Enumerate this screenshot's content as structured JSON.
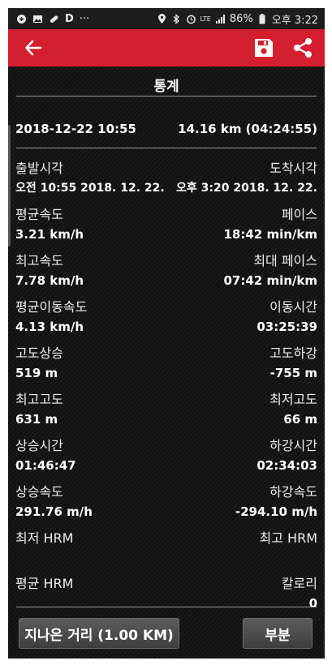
{
  "status_bar": {
    "left_icons": [
      "app-icon",
      "gallery-icon",
      "pill-icon",
      "d-icon",
      "more-dots-icon"
    ],
    "right_icons": [
      "location-icon",
      "bluetooth-icon",
      "alarm-icon",
      "lte-icon",
      "signal-icon",
      "battery-icon"
    ],
    "more_dots": "···",
    "d_letter": "D",
    "lte": "LTE",
    "battery": "86%",
    "time": "오후 3:22"
  },
  "app_bar": {
    "accent": "#d4202e"
  },
  "stats": {
    "title": "통계",
    "date_time": "2018-12-22 10:55",
    "distance_duration": "14.16 km (04:24:55)",
    "rows": [
      {
        "left_label": "출발시각",
        "right_label": "도착시각",
        "left_value": "오전 10:55 2018. 12. 22.",
        "right_value": "오후 3:20 2018. 12. 22."
      },
      {
        "left_label": "평균속도",
        "right_label": "페이스",
        "left_value": "3.21 km/h",
        "right_value": "18:42 min/km"
      },
      {
        "left_label": "최고속도",
        "right_label": "최대 페이스",
        "left_value": "7.78 km/h",
        "right_value": "07:42 min/km"
      },
      {
        "left_label": "평균이동속도",
        "right_label": "이동시간",
        "left_value": "4.13 km/h",
        "right_value": "03:25:39"
      },
      {
        "left_label": "고도상승",
        "right_label": "고도하강",
        "left_value": "519 m",
        "right_value": "-755 m"
      },
      {
        "left_label": "최고고도",
        "right_label": "최저고도",
        "left_value": "631 m",
        "right_value": "66 m"
      },
      {
        "left_label": "상승시간",
        "right_label": "하강시간",
        "left_value": "01:46:47",
        "right_value": "02:34:03"
      },
      {
        "left_label": "상승속도",
        "right_label": "하강속도",
        "left_value": "291.76 m/h",
        "right_value": "-294.10 m/h"
      },
      {
        "left_label": "최저 HRM",
        "right_label": "최고 HRM",
        "left_value": "",
        "right_value": ""
      },
      {
        "left_label": "평균 HRM",
        "right_label": "칼로리",
        "left_value": "",
        "right_value": "0"
      }
    ]
  },
  "buttons": {
    "distance": "지나온 거리 (1.00  KM)",
    "part": "부분"
  }
}
